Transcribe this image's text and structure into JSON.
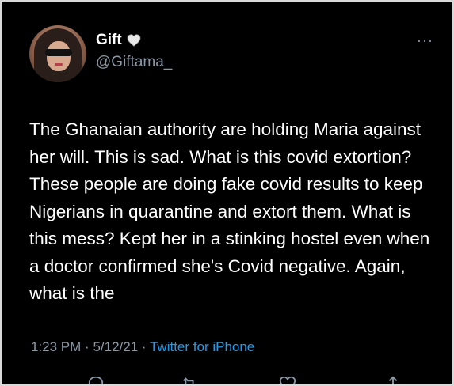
{
  "user": {
    "name": "Gift",
    "handle": "@Giftama_"
  },
  "tweet": {
    "text": "The Ghanaian authority are holding Maria against her will. This is sad. What is this covid extortion? These people are doing fake covid results to keep Nigerians in quarantine and extort them. What is this mess? Kept her in a stinking hostel even when a doctor confirmed she's Covid negative. Again, what is the",
    "time": "1:23 PM",
    "date": "5/12/21",
    "source": "Twitter for iPhone"
  },
  "icons": {
    "more": "more-horizontal-icon",
    "name_badge": "white-heart-icon",
    "reply": "reply-icon",
    "retweet": "retweet-icon",
    "like": "like-icon",
    "share": "share-icon"
  },
  "colors": {
    "background": "#000000",
    "text": "#ffffff",
    "muted": "#8b98a5",
    "link": "#1d9bf0"
  }
}
